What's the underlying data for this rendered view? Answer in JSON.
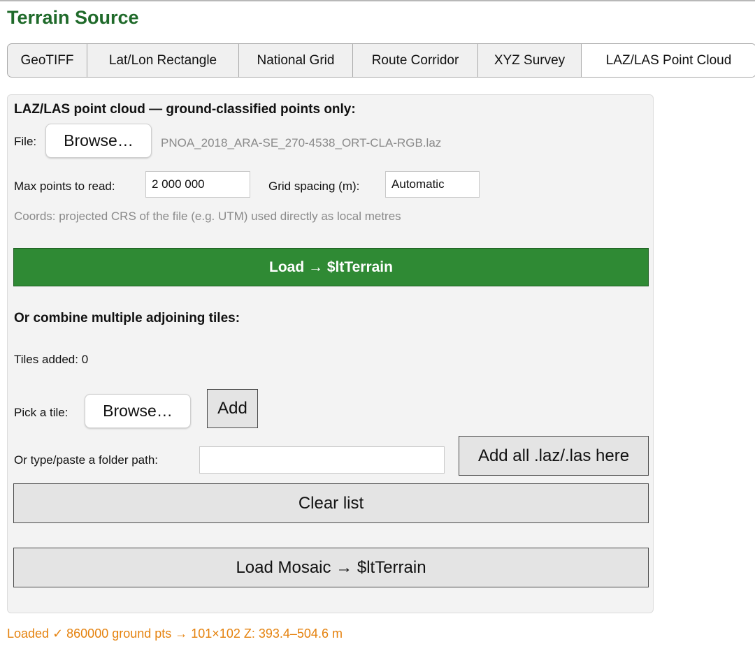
{
  "title": "Terrain Source",
  "tabs": [
    {
      "label": "GeoTIFF",
      "active": false
    },
    {
      "label": "Lat/Lon Rectangle",
      "active": false
    },
    {
      "label": "National Grid",
      "active": false
    },
    {
      "label": "Route Corridor",
      "active": false
    },
    {
      "label": "XYZ Survey",
      "active": false
    },
    {
      "label": "LAZ/LAS Point Cloud",
      "active": true
    }
  ],
  "panel": {
    "heading": "LAZ/LAS point cloud — ground-classified points only:",
    "file_label": "File:",
    "browse_label": "Browse…",
    "file_name": "PNOA_2018_ARA-SE_270-4538_ORT-CLA-RGB.laz",
    "max_points_label": "Max points to read:",
    "max_points_value": "2 000 000",
    "grid_spacing_label": "Grid spacing (m):",
    "grid_spacing_value": "Automatic",
    "coords_note": "Coords: projected CRS of the file (e.g. UTM) used directly as local metres",
    "load_button": "Load → $ltTerrain",
    "combine_heading": "Or combine multiple adjoining tiles:",
    "tiles_added": "Tiles added: 0",
    "pick_tile_label": "Pick a tile:",
    "pick_browse_label": "Browse…",
    "add_button": "Add",
    "folder_label": "Or type/paste a folder path:",
    "folder_value": "",
    "add_all_button": "Add all .laz/.las here",
    "clear_button": "Clear list",
    "mosaic_button": "Load Mosaic → $ltTerrain"
  },
  "status": "Loaded ✓ 860000 ground pts → 101×102  Z: 393.4–504.6 m",
  "colors": {
    "title": "#1f6a2a",
    "load_button_bg": "#2f8a34",
    "status_text": "#e5820e"
  }
}
